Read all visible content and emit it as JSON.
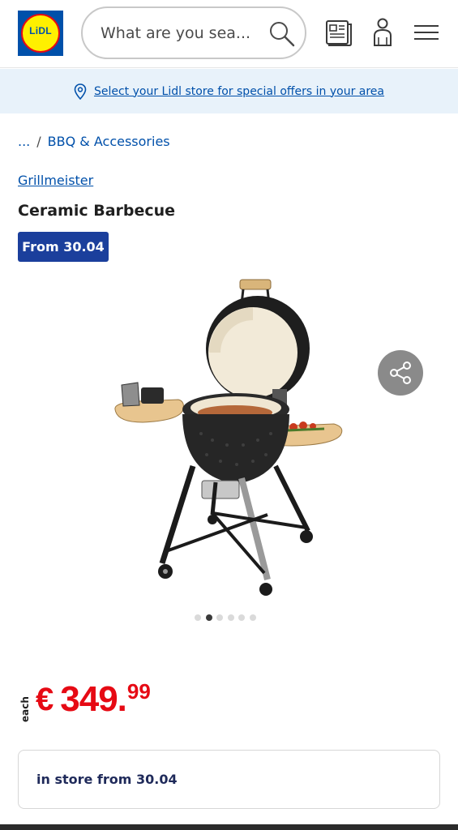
{
  "header": {
    "logo_text": "LiDL",
    "search_placeholder": "What are you sea..."
  },
  "store_banner": {
    "link_text": "Select your Lidl store for special offers in your area"
  },
  "breadcrumb": {
    "ellipsis": "...",
    "separator": "/",
    "category": "BBQ & Accessories"
  },
  "product": {
    "brand": "Grillmeister",
    "title": "Ceramic Barbecue",
    "date_badge": "From 30.04",
    "gallery": {
      "total_images": 6,
      "active_index": 2
    },
    "price": {
      "unit": "each",
      "currency": "€",
      "whole": "349.",
      "cents": "99"
    },
    "availability": "in store from 30.04"
  },
  "colors": {
    "brand_blue": "#0050aa",
    "badge_blue": "#1b3f9c",
    "price_red": "#e60a14",
    "logo_yellow": "#fff000"
  }
}
